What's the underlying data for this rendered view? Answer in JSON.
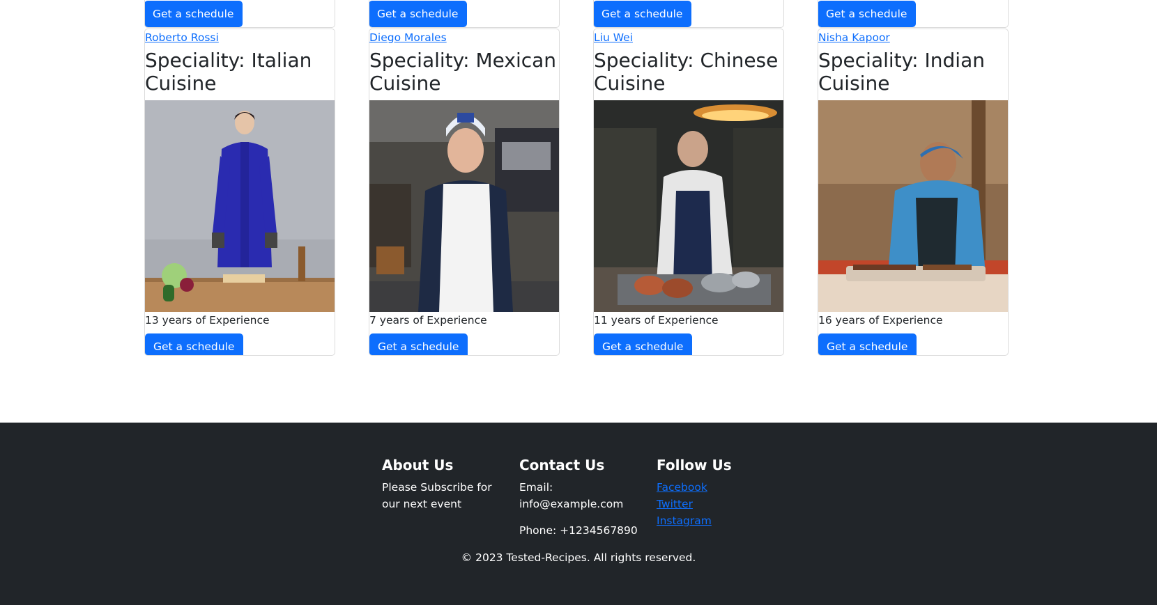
{
  "top_row": [
    {
      "button": "Get a schedule"
    },
    {
      "button": "Get a schedule"
    },
    {
      "button": "Get a schedule"
    },
    {
      "button": "Get a schedule"
    }
  ],
  "chefs": [
    {
      "name": "Roberto Rossi",
      "speciality": "Speciality: Italian Cuisine",
      "experience": "13 years of Experience",
      "button": "Get a schedule",
      "photo": "Chef in blue jacket with vegetables"
    },
    {
      "name": "Diego Morales",
      "speciality": "Speciality: Mexican Cuisine",
      "experience": "7 years of Experience",
      "button": "Get a schedule",
      "photo": "Chef in white apron in kitchen"
    },
    {
      "name": "Liu Wei",
      "speciality": "Speciality: Chinese Cuisine",
      "experience": "11 years of Experience",
      "button": "Get a schedule",
      "photo": "Chef in striped apron roasting food"
    },
    {
      "name": "Nisha Kapoor",
      "speciality": "Speciality: Indian Cuisine",
      "experience": "16 years of Experience",
      "button": "Get a schedule",
      "photo": "Chef in blue shirt slicing meat"
    }
  ],
  "footer": {
    "about": {
      "title": "About Us",
      "text": "Please Subscribe for our next event"
    },
    "contact": {
      "title": "Contact Us",
      "email": "Email: info@example.com",
      "phone": "Phone: +1234567890"
    },
    "follow": {
      "title": "Follow Us",
      "links": [
        "Facebook",
        "Twitter",
        "Instagram"
      ]
    },
    "copyright": "© 2023 Tested-Recipes. All rights reserved."
  },
  "colors": {
    "primary": "#0d6efd",
    "footer_bg": "#212529"
  }
}
